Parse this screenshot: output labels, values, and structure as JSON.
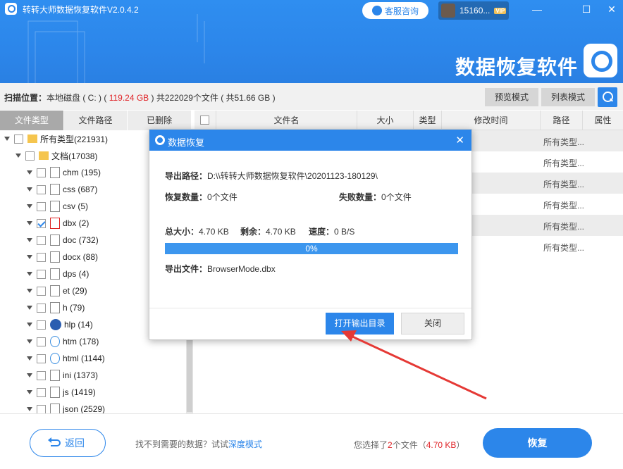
{
  "window": {
    "title": "转转大师数据恢复软件V2.0.4.2",
    "service_label": "客服咨询",
    "user_label": "15160...",
    "vip_label": "VIP",
    "minimize_glyph": "—",
    "maximize_glyph": "☐",
    "close_glyph": "✕"
  },
  "brand": {
    "name": "数据恢复软件"
  },
  "scan": {
    "label": "扫描位置：",
    "location": "本地磁盘 ( C: ) ( ",
    "size": "119.24 GB",
    "rest": " ) 共222029个文件 ( 共51.66 GB )"
  },
  "view_modes": {
    "preview": "预览模式",
    "list": "列表模式"
  },
  "tabs": [
    {
      "label": "文件类型"
    },
    {
      "label": "文件路径"
    },
    {
      "label": "已删除"
    }
  ],
  "tree": [
    {
      "label": "所有类型(221931)",
      "icon": "folder-icon"
    },
    {
      "label": "文档(17038)",
      "icon": "folder-icon"
    },
    {
      "label": "chm (195)",
      "icon": "chm-file-icon"
    },
    {
      "label": "css (687)",
      "icon": "css-file-icon"
    },
    {
      "label": "csv (5)",
      "icon": "csv-file-icon"
    },
    {
      "label": "dbx (2)",
      "icon": "pdf-file-icon",
      "checked": true
    },
    {
      "label": "doc (732)",
      "icon": "doc-file-icon"
    },
    {
      "label": "docx (88)",
      "icon": "docx-file-icon"
    },
    {
      "label": "dps (4)",
      "icon": "dps-file-icon"
    },
    {
      "label": "et (29)",
      "icon": "et-file-icon"
    },
    {
      "label": "h (79)",
      "icon": "h-file-icon"
    },
    {
      "label": "hlp (14)",
      "icon": "help-icon"
    },
    {
      "label": "htm (178)",
      "icon": "web-file-icon"
    },
    {
      "label": "html (1144)",
      "icon": "web-file-icon"
    },
    {
      "label": "ini (1373)",
      "icon": "ini-file-icon"
    },
    {
      "label": "js (1419)",
      "icon": "js-file-icon"
    },
    {
      "label": "json (2529)",
      "icon": "json-file-icon"
    }
  ],
  "table": {
    "columns": [
      "文件名",
      "大小",
      "类型",
      "修改时间",
      "路径",
      "属性"
    ],
    "rows": [
      {
        "path": "所有类型..."
      },
      {
        "path": "所有类型..."
      },
      {
        "path": "所有类型..."
      },
      {
        "path": "所有类型..."
      },
      {
        "path": "所有类型..."
      },
      {
        "path": "所有类型..."
      }
    ]
  },
  "dialog": {
    "title": "数据恢复",
    "close_glyph": "✕",
    "export_path_label": "导出路径：",
    "export_path": "D:\\\\转转大师数据恢复软件\\20201123-180129\\",
    "recovered_label": "恢复数量：",
    "recovered": "0个文件",
    "failed_label": "失败数量：",
    "failed": "0个文件",
    "total_label": "总大小：",
    "total": "4.70 KB",
    "remaining_label": "剩余：",
    "remaining": "4.70 KB",
    "speed_label": "速度：",
    "speed": "0 B/S",
    "progress": 0,
    "progress_text": "0%",
    "export_file_label": "导出文件：",
    "export_file": "BrowserMode.dbx",
    "open_button": "打开输出目录",
    "close_button": "关闭"
  },
  "bottom": {
    "back_label": "返回",
    "hint": "找不到需要的数据？试试",
    "hint_link": "深度模式",
    "selected_prefix": "您选择了",
    "selected_count": "2",
    "selected_mid": "个文件（",
    "selected_size": "4.70 KB",
    "selected_suffix": "）",
    "recover_label": "恢复"
  },
  "colors": {
    "accent": "#2c86ea",
    "highlight": "#e0262a",
    "annotation_arrow": "#e53935"
  }
}
